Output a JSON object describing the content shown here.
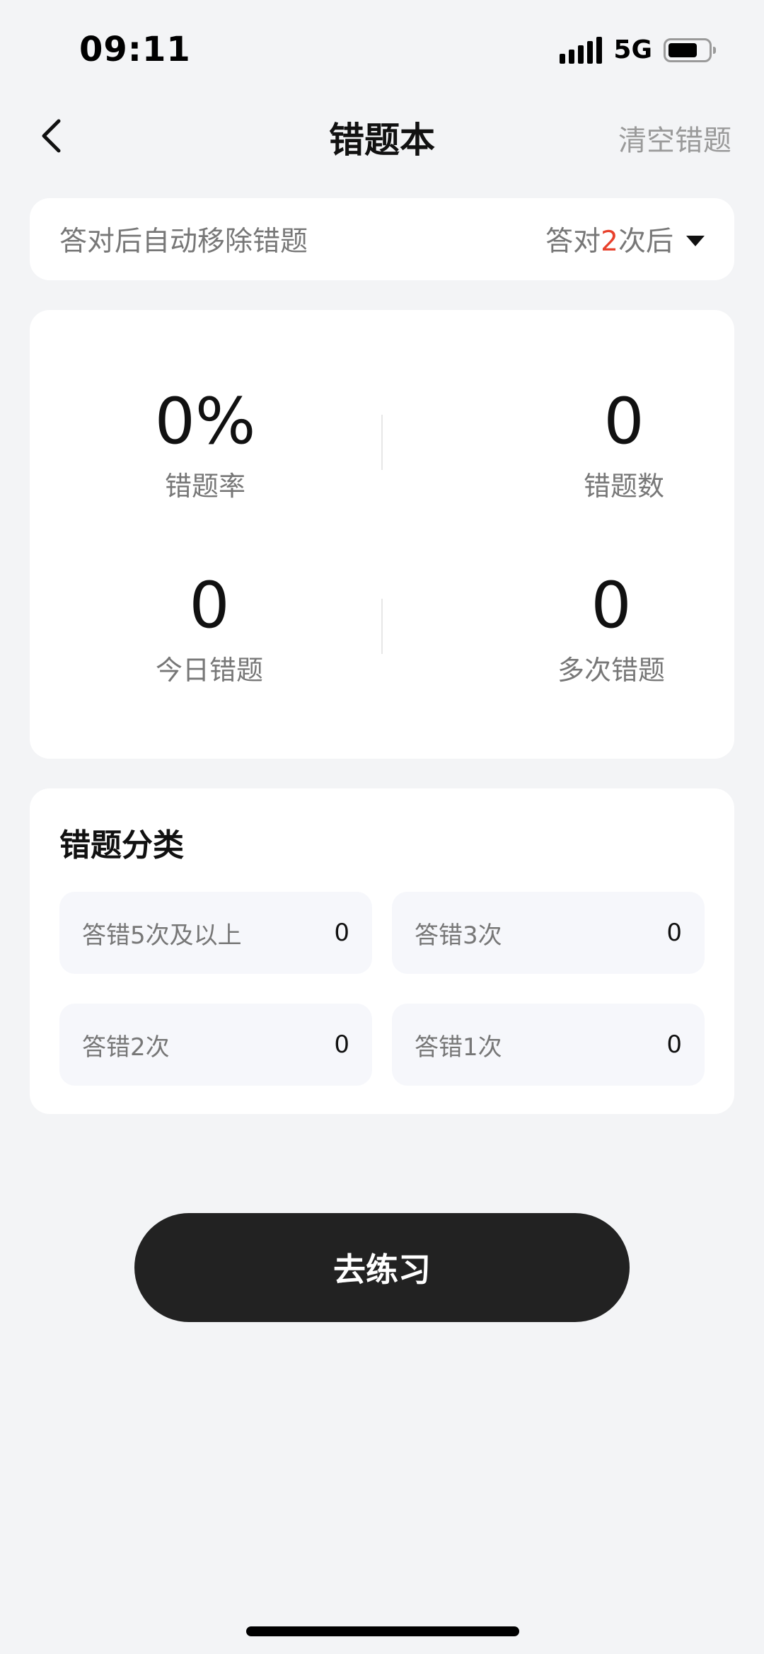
{
  "status_bar": {
    "time": "09:11",
    "network": "5G",
    "icons": [
      "signal-icon",
      "battery-icon"
    ]
  },
  "nav": {
    "title": "错题本",
    "clear_label": "清空错题",
    "back_icon": "chevron-left-icon"
  },
  "auto_remove": {
    "label": "答对后自动移除错题",
    "select_prefix": "答对",
    "select_count": "2",
    "select_suffix": "次后",
    "dropdown_icon": "caret-down-icon"
  },
  "stats": {
    "error_rate": {
      "value": "0%",
      "label": "错题率"
    },
    "error_count": {
      "value": "0",
      "label": "错题数"
    },
    "today_errors": {
      "value": "0",
      "label": "今日错题"
    },
    "repeat_errors": {
      "value": "0",
      "label": "多次错题"
    }
  },
  "categories": {
    "title": "错题分类",
    "items": [
      {
        "label": "答错5次及以上",
        "count": "0"
      },
      {
        "label": "答错3次",
        "count": "0"
      },
      {
        "label": "答错2次",
        "count": "0"
      },
      {
        "label": "答错1次",
        "count": "0"
      }
    ]
  },
  "practice_button": {
    "label": "去练习"
  },
  "colors": {
    "background": "#f3f4f6",
    "card": "#ffffff",
    "accent_red": "#e8412c",
    "button_dark": "#222222",
    "muted_text": "#777777"
  }
}
